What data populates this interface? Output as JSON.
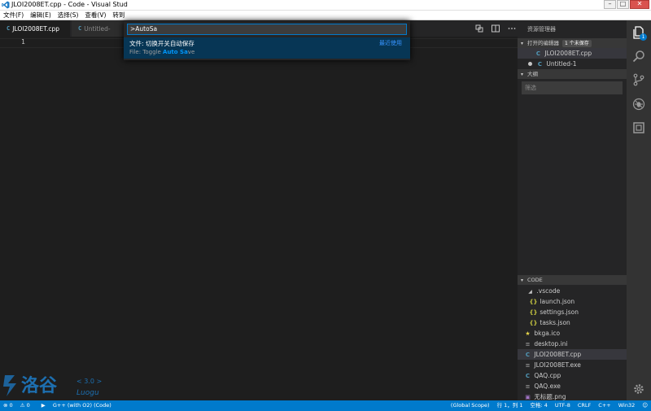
{
  "window": {
    "title": "JLOI2008ET.cpp - Code - Visual Stud",
    "minimize": "–",
    "maximize": "□",
    "close": "✕"
  },
  "menu": [
    "文件(F)",
    "编辑(E)",
    "选择(S)",
    "查看(V)",
    "转到"
  ],
  "tabs": [
    {
      "label": "JLOI2008ET.cpp",
      "icon": "c-file-icon",
      "active": true
    },
    {
      "label": "Untitled-",
      "icon": "c-file-icon",
      "active": false
    }
  ],
  "editor": {
    "line_numbers": [
      "1"
    ]
  },
  "palette": {
    "input_value": ">AutoSa",
    "results": [
      {
        "title": "文件: 切换开关自动保存",
        "detail_prefix": "File: Toggle ",
        "detail_match": "Auto Sa",
        "detail_suffix": "ve",
        "tag": "最近使用"
      }
    ]
  },
  "explorer": {
    "title": "资源管理器",
    "open_editors": {
      "header": "打开的编辑器",
      "badge": "1 个未保存",
      "items": [
        {
          "label": "JLOI2008ET.cpp",
          "icon": "c-file-icon",
          "dirty": false,
          "selected": true
        },
        {
          "label": "Untitled-1",
          "icon": "c-file-icon",
          "dirty": true,
          "selected": false
        }
      ]
    },
    "outline": {
      "header": "大纲",
      "filter_placeholder": "筛选"
    },
    "folder": {
      "header": "CODE",
      "items": [
        {
          "label": ".vscode",
          "icon": "folder-open-icon",
          "indent": 1,
          "selected": false
        },
        {
          "label": "launch.json",
          "icon": "json-icon",
          "indent": 2,
          "selected": false
        },
        {
          "label": "settings.json",
          "icon": "json-icon",
          "indent": 2,
          "selected": false
        },
        {
          "label": "tasks.json",
          "icon": "json-icon",
          "indent": 2,
          "selected": false
        },
        {
          "label": "bkga.ico",
          "icon": "star-icon",
          "indent": 1,
          "selected": false
        },
        {
          "label": "desktop.ini",
          "icon": "text-file-icon",
          "indent": 1,
          "selected": false
        },
        {
          "label": "JLOI2008ET.cpp",
          "icon": "c-file-icon",
          "indent": 1,
          "selected": true
        },
        {
          "label": "JLOI2008ET.exe",
          "icon": "text-file-icon",
          "indent": 1,
          "selected": false
        },
        {
          "label": "QAQ.cpp",
          "icon": "c-file-icon",
          "indent": 1,
          "selected": false
        },
        {
          "label": "QAQ.exe",
          "icon": "text-file-icon",
          "indent": 1,
          "selected": false
        },
        {
          "label": "无标题.png",
          "icon": "image-file-icon",
          "indent": 1,
          "selected": false
        }
      ]
    }
  },
  "activity_bar": {
    "explorer_badge": "1",
    "icons": [
      "files-icon",
      "search-icon",
      "source-control-icon",
      "debug-icon",
      "extensions-icon",
      "settings-gear-icon"
    ]
  },
  "watermark": {
    "chinese": "洛谷",
    "version": "< 3.0 >",
    "latin": "Luogu"
  },
  "status": {
    "errors": "0",
    "warnings": "0",
    "run_label": "G++ (with O2) (Code)",
    "scope": "(Global Scope)",
    "position": "行 1，列 1",
    "indent": "空格: 4",
    "encoding": "UTF-8",
    "eol": "CRLF",
    "language": "C++",
    "platform": "Win32"
  },
  "colors": {
    "accent": "#007acc",
    "editor_bg": "#1e1e1e",
    "sidebar_bg": "#252526",
    "palette_selected": "#073655",
    "match_highlight": "#0097fb"
  }
}
